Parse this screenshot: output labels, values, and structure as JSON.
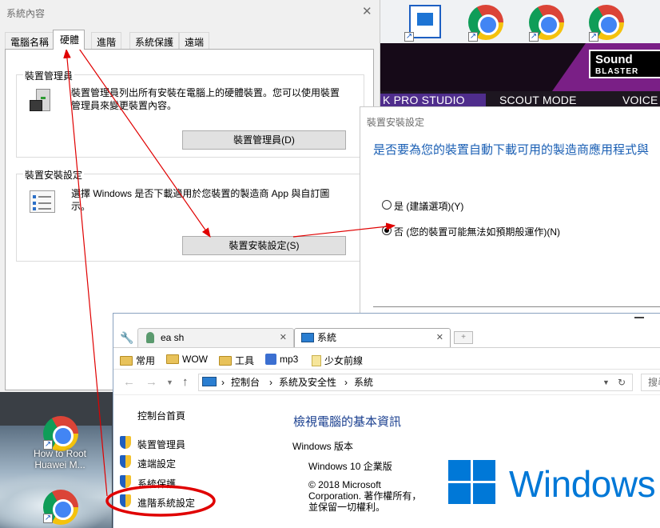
{
  "system_properties": {
    "title": "系統內容",
    "close": "✕",
    "tabs": [
      "電腦名稱",
      "硬體",
      "進階",
      "系統保護",
      "遠端"
    ],
    "device_manager": {
      "group_title": "裝置管理員",
      "text_line1": "裝置管理員列出所有安裝在電腦上的硬體裝置。您可以使用裝置",
      "text_line2": "管理員來變更裝置內容。",
      "button": "裝置管理員(D)"
    },
    "device_install": {
      "group_title": "裝置安裝設定",
      "text_line1": "選擇 Windows 是否下載適用於您裝置的製造商 App 與自訂圖",
      "text_line2": "示。",
      "button": "裝置安裝設定(S)"
    }
  },
  "device_install_dialog": {
    "title": "裝置安裝設定",
    "question": "是否要為您的裝置自動下載可用的製造商應用程式與",
    "options": [
      {
        "label": "是 (建議選項)(Y)",
        "checked": false
      },
      {
        "label": "否 (您的裝置可能無法如預期般運作)(N)",
        "checked": true
      }
    ]
  },
  "background_app": {
    "tabs": [
      "K PRO STUDIO",
      "SCOUT MODE",
      "VOICE"
    ],
    "logo_line1": "Sound",
    "logo_line2": "BLASTER"
  },
  "desktop": {
    "icon_label_line1": "How to Root",
    "icon_label_line2": "Huawei M..."
  },
  "browser": {
    "tabs": [
      {
        "label": "ea sh",
        "active": false
      },
      {
        "label": "系統",
        "active": true
      }
    ],
    "tab_close": "✕",
    "new_tab": "+",
    "bookmarks": [
      "常用",
      "WOW",
      "工具",
      "mp3",
      "少女前線"
    ],
    "breadcrumb": [
      "控制台",
      "系統及安全性",
      "系統"
    ],
    "search_placeholder": "搜尋",
    "sidebar": {
      "home": "控制台首頁",
      "links": [
        "裝置管理員",
        "遠端設定",
        "系統保護",
        "進階系統設定"
      ]
    },
    "main": {
      "heading": "檢視電腦的基本資訊",
      "section": "Windows 版本",
      "edition": "Windows 10 企業版",
      "copyright_line1": "© 2018 Microsoft",
      "copyright_line2": "Corporation. 著作權所有，",
      "copyright_line3": "並保留一切權利。",
      "brand": "Windows"
    }
  },
  "colors": {
    "accent_blue": "#1a5fb4",
    "windows_blue": "#0078d7",
    "annotation_red": "#e00000"
  }
}
